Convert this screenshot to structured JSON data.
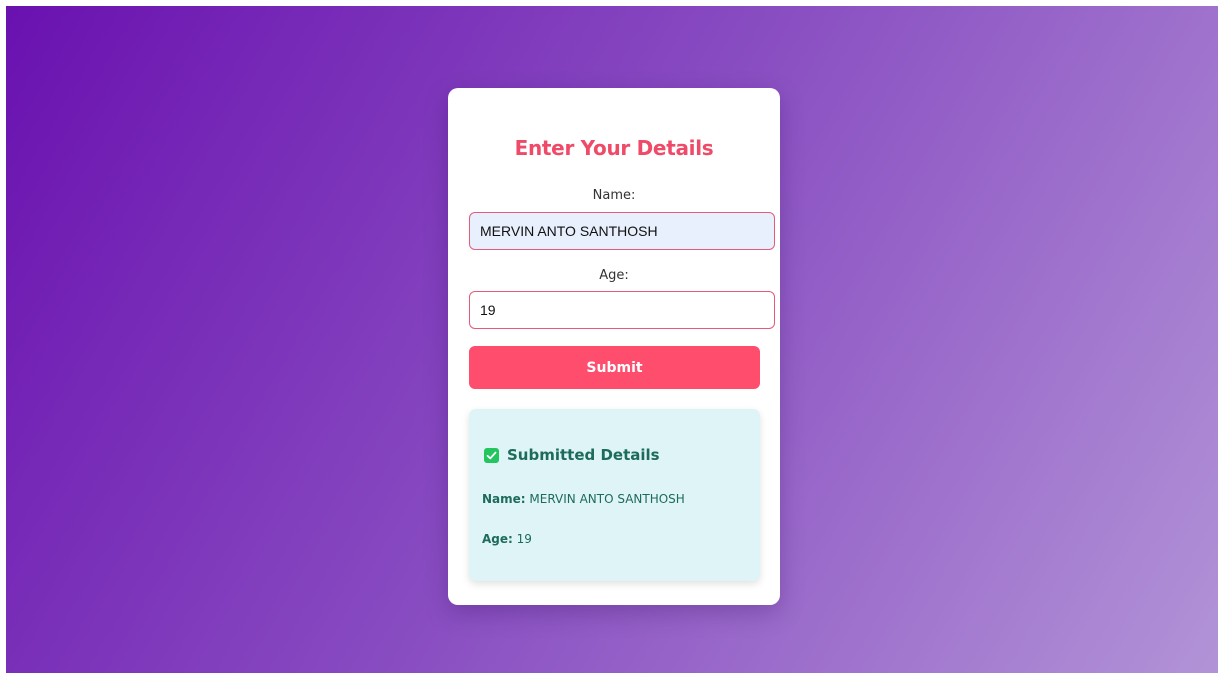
{
  "form": {
    "title": "Enter Your Details",
    "name_label": "Name:",
    "name_value": "MERVIN ANTO SANTHOSH",
    "age_label": "Age:",
    "age_value": "19",
    "submit_label": "Submit"
  },
  "result": {
    "icon": "check-icon",
    "title": "Submitted Details",
    "name_key": "Name:",
    "name_value": "MERVIN ANTO SANTHOSH",
    "age_key": "Age:",
    "age_value": "19"
  },
  "colors": {
    "accent": "#ff4d6d",
    "title": "#ef4a68",
    "result_text": "#1d6b5a",
    "result_bg": "#dff4f7",
    "check": "#22c55e"
  }
}
